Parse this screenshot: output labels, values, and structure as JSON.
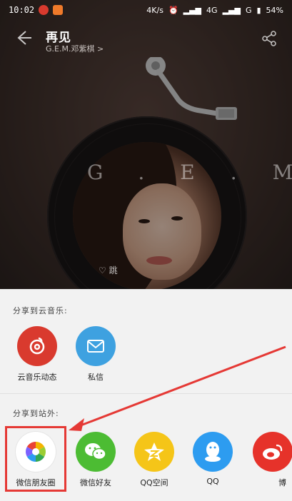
{
  "status_bar": {
    "time": "10:02",
    "network_speed": "4K/s",
    "network_type": "4G",
    "carrier": "G",
    "battery": "54%"
  },
  "player": {
    "song_title": "再见",
    "artist": "G.E.M.邓紫棋 >",
    "cover_text": "G.E.M",
    "beat_label": "跳"
  },
  "share": {
    "section_internal": "分享到云音乐:",
    "internal_items": [
      {
        "label": "云音乐动态",
        "icon": "netease-music-icon",
        "color": "#d93a2e"
      },
      {
        "label": "私信",
        "icon": "mail-icon",
        "color": "#3ea1e0"
      }
    ],
    "section_external": "分享到站外:",
    "external_items": [
      {
        "label": "微信朋友圈",
        "icon": "wechat-moments-icon",
        "color": "#ffffff"
      },
      {
        "label": "微信好友",
        "icon": "wechat-icon",
        "color": "#4cbc33"
      },
      {
        "label": "QQ空间",
        "icon": "qzone-icon",
        "color": "#f5c518"
      },
      {
        "label": "QQ",
        "icon": "qq-icon",
        "color": "#2d9cf0"
      },
      {
        "label": "博",
        "icon": "weibo-icon",
        "color": "#e6322a"
      }
    ]
  },
  "colors": {
    "highlight": "#e53935",
    "accent_red": "#d93a2e"
  }
}
